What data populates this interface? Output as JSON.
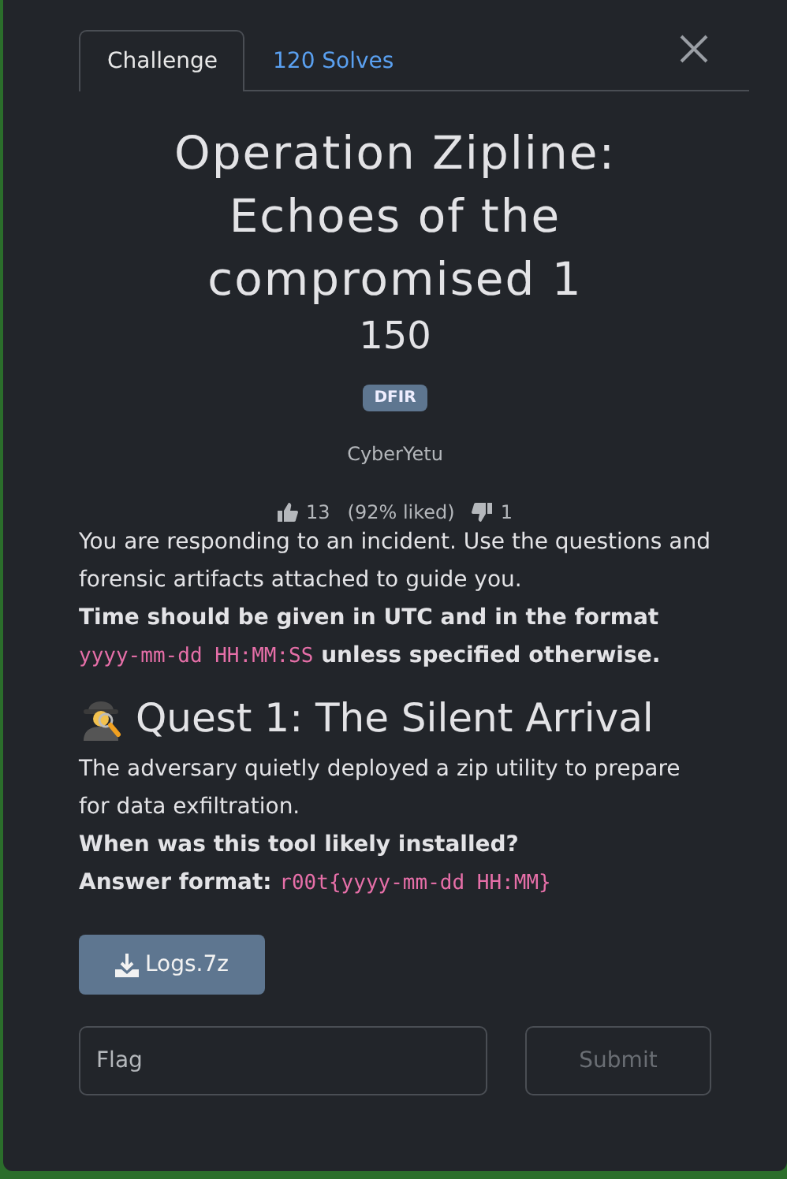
{
  "tabs": [
    {
      "label": "Challenge",
      "selected": true
    },
    {
      "label": "120 Solves",
      "selected": false
    }
  ],
  "title": "Operation Zipline: Echoes of the compromised 1",
  "points": "150",
  "tags": [
    "DFIR"
  ],
  "author": "CyberYetu",
  "votes": {
    "likes": "13",
    "ratio": "(92% liked)",
    "dislikes": "1"
  },
  "intro": [
    [
      {
        "kind": "text",
        "text": "You are responding to an incident. Use the questions and forensic artifacts attached to guide you."
      }
    ],
    [
      {
        "kind": "bold",
        "text": "Time should be given in UTC and in the format "
      },
      {
        "kind": "code",
        "text": "yyyy-mm-dd HH:MM:SS"
      },
      {
        "kind": "bold",
        "text": " unless specified otherwise."
      }
    ]
  ],
  "quest": {
    "heading": "Quest 1: The Silent Arrival",
    "paragraphs": [
      [
        {
          "kind": "text",
          "text": "The adversary quietly deployed a zip utility to prepare for data exfiltration."
        }
      ],
      [
        {
          "kind": "bold",
          "text": "When was this tool likely installed?"
        }
      ],
      [
        {
          "kind": "bold",
          "text": "Answer format: "
        },
        {
          "kind": "code",
          "text": "r00t{yyyy-mm-dd HH:MM}"
        }
      ]
    ]
  },
  "files": [
    "Logs.7z"
  ],
  "flag": {
    "placeholder": "Flag"
  },
  "submit": {
    "label": "Submit",
    "disabled": true
  }
}
